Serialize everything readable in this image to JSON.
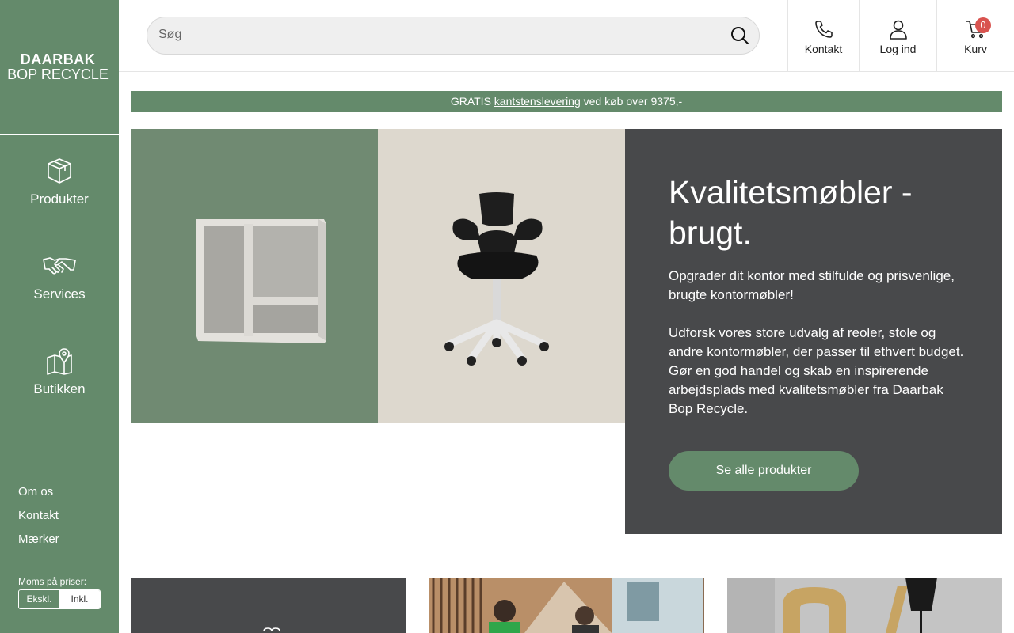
{
  "sidebar": {
    "logo_line1": "DAARBAK",
    "logo_line2": "BOP RECYCLE",
    "nav": [
      {
        "label": "Produkter",
        "icon": "box-icon"
      },
      {
        "label": "Services",
        "icon": "handshake-icon"
      },
      {
        "label": "Butikken",
        "icon": "map-pin-icon"
      }
    ],
    "links": [
      "Om os",
      "Kontakt",
      "Mærker"
    ],
    "moms_label": "Moms på priser:",
    "moms_options": [
      "Ekskl.",
      "Inkl."
    ],
    "moms_selected": "Inkl."
  },
  "header": {
    "search_placeholder": "Søg",
    "buttons": [
      {
        "label": "Kontakt",
        "icon": "phone-icon"
      },
      {
        "label": "Log ind",
        "icon": "user-icon"
      },
      {
        "label": "Kurv",
        "icon": "cart-icon",
        "badge": "0"
      }
    ]
  },
  "promo": {
    "prefix": "GRATIS",
    "link": "kantstenslevering",
    "suffix": "ved køb over 9375,-"
  },
  "hero": {
    "title": "Kvalitetsmøbler - brugt.",
    "text1": "Opgrader dit kontor med stilfulde og prisvenlige, brugte kontormøbler!",
    "text2": "Udforsk vores store udvalg af reoler, stole og andre kontormøbler, der passer til ethvert budget. Gør en god handel og skab en inspirerende arbejdsplads med kvalitetsmøbler fra Daarbak Bop Recycle.",
    "button": "Se alle produkter"
  },
  "colors": {
    "brand_green": "#648a6b",
    "dark_panel": "#48494b",
    "badge_red": "#d9534f"
  }
}
